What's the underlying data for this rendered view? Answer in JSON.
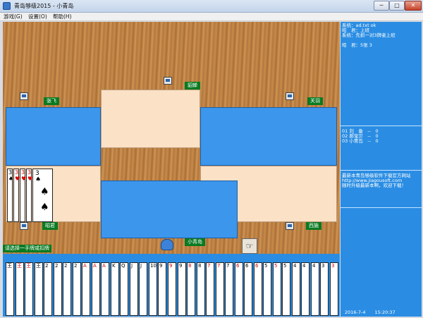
{
  "window": {
    "title": "青岛够级2015 - 小青岛",
    "min_glyph": "─",
    "max_glyph": "□",
    "close_glyph": "✕"
  },
  "menu": [
    "游戏(G)",
    "设置(O)",
    "帮助(H)"
  ],
  "players": {
    "top": "貂蝉",
    "left": "张飞",
    "right": "关羽",
    "bottom_left": "昭君",
    "bottom_right": "西施",
    "self": "小青岛"
  },
  "played_cards": [
    {
      "rank": "3",
      "suit": "♠",
      "color": "black"
    },
    {
      "rank": "3",
      "suit": "♥",
      "color": "red"
    },
    {
      "rank": "3",
      "suit": "♥",
      "color": "red"
    },
    {
      "rank": "3",
      "suit": "♠",
      "color": "black"
    }
  ],
  "status_message": "请选择一手牌或扣牌",
  "right_panel": {
    "log": "系统：ad.txt ok\n昭　君：上班\n系统：先抓一对3牌者上班\n\n昭　君：5张 3",
    "scores": "01 刘　备　--　0\n02 郝宝贝　--　0\n03 小青岛　--　0",
    "news": "最新本青岛够级软件下载官方网站\nhttp://www.jiagousoft.com\n随时升级最新本啊，欢迎下载！",
    "datetime": "2016-7-4　　15:20:37"
  },
  "hand_cards": [
    {
      "rank": "王",
      "color": "black"
    },
    {
      "rank": "王",
      "color": "red"
    },
    {
      "rank": "王",
      "color": "red"
    },
    {
      "rank": "王",
      "color": "black"
    },
    {
      "rank": "2",
      "color": "black"
    },
    {
      "rank": "2",
      "color": "black"
    },
    {
      "rank": "2",
      "color": "black"
    },
    {
      "rank": "2",
      "color": "black"
    },
    {
      "rank": "A",
      "color": "red"
    },
    {
      "rank": "A",
      "color": "red"
    },
    {
      "rank": "A",
      "color": "red"
    },
    {
      "rank": "K",
      "color": "black"
    },
    {
      "rank": "Q",
      "color": "black"
    },
    {
      "rank": "J",
      "color": "black"
    },
    {
      "rank": "J",
      "color": "black"
    },
    {
      "rank": "10",
      "color": "black"
    },
    {
      "rank": "9",
      "color": "black"
    },
    {
      "rank": "9",
      "color": "red"
    },
    {
      "rank": "9",
      "color": "black"
    },
    {
      "rank": "8",
      "color": "red"
    },
    {
      "rank": "8",
      "color": "black"
    },
    {
      "rank": "7",
      "color": "red"
    },
    {
      "rank": "7",
      "color": "red"
    },
    {
      "rank": "7",
      "color": "black"
    },
    {
      "rank": "6",
      "color": "red"
    },
    {
      "rank": "6",
      "color": "black"
    },
    {
      "rank": "6",
      "color": "red"
    },
    {
      "rank": "5",
      "color": "black"
    },
    {
      "rank": "5",
      "color": "red"
    },
    {
      "rank": "5",
      "color": "black"
    },
    {
      "rank": "4",
      "color": "black"
    },
    {
      "rank": "4",
      "color": "black"
    },
    {
      "rank": "4",
      "color": "black"
    },
    {
      "rank": "3",
      "color": "black"
    },
    {
      "rank": "3",
      "color": "red"
    }
  ],
  "hand_action_glyph": "☞"
}
